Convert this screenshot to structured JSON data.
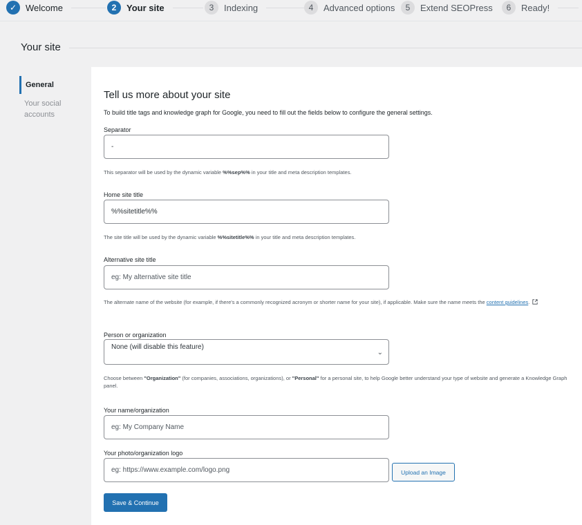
{
  "steps": [
    {
      "num": "✓",
      "label": "Welcome",
      "state": "done"
    },
    {
      "num": "2",
      "label": "Your site",
      "state": "current"
    },
    {
      "num": "3",
      "label": "Indexing",
      "state": "todo"
    },
    {
      "num": "4",
      "label": "Advanced options",
      "state": "todo"
    },
    {
      "num": "5",
      "label": "Extend SEOPress",
      "state": "todo"
    },
    {
      "num": "6",
      "label": "Ready!",
      "state": "todo"
    }
  ],
  "section": {
    "title": "Your site"
  },
  "sidenav": {
    "items": [
      {
        "label": "General"
      },
      {
        "label": "Your social accounts"
      }
    ]
  },
  "panel": {
    "heading": "Tell us more about your site",
    "description": "To build title tags and knowledge graph for Google, you need to fill out the fields below to configure the general settings.",
    "separator": {
      "label": "Separator",
      "value": "-",
      "help_pre": "This separator will be used by the dynamic variable ",
      "help_var": "%%sep%%",
      "help_post": " in your title and meta description templates."
    },
    "home_title": {
      "label": "Home site title",
      "value": "%%sitetitle%%",
      "help_pre": "The site title will be used by the dynamic variable ",
      "help_var": "%%sitetitle%%",
      "help_post": " in your title and meta description templates."
    },
    "alt_title": {
      "label": "Alternative site title",
      "placeholder": "eg: My alternative site title",
      "help_pre": "The alternate name of the website (for example, if there's a commonly recognized acronym or shorter name for your site), if applicable. Make sure the name meets the ",
      "help_link": "content guidelines",
      "help_post": "."
    },
    "person_org": {
      "label": "Person or organization",
      "selected": "None (will disable this feature)",
      "help_1": "Choose between ",
      "help_org": "\"Organization\"",
      "help_2": " (for companies, associations, organizations), or ",
      "help_pers": "\"Personal\"",
      "help_3": " for a personal site, to help Google better understand your type of website and generate a Knowledge Graph panel."
    },
    "name_org": {
      "label": "Your name/organization",
      "placeholder": "eg: My Company Name"
    },
    "logo": {
      "label": "Your photo/organization logo",
      "placeholder": "eg: https://www.example.com/logo.png",
      "upload_label": "Upload an Image"
    },
    "save_label": "Save & Continue"
  },
  "colors": {
    "accent": "#2271b1",
    "background": "#f0f0f1",
    "panel": "#ffffff"
  }
}
